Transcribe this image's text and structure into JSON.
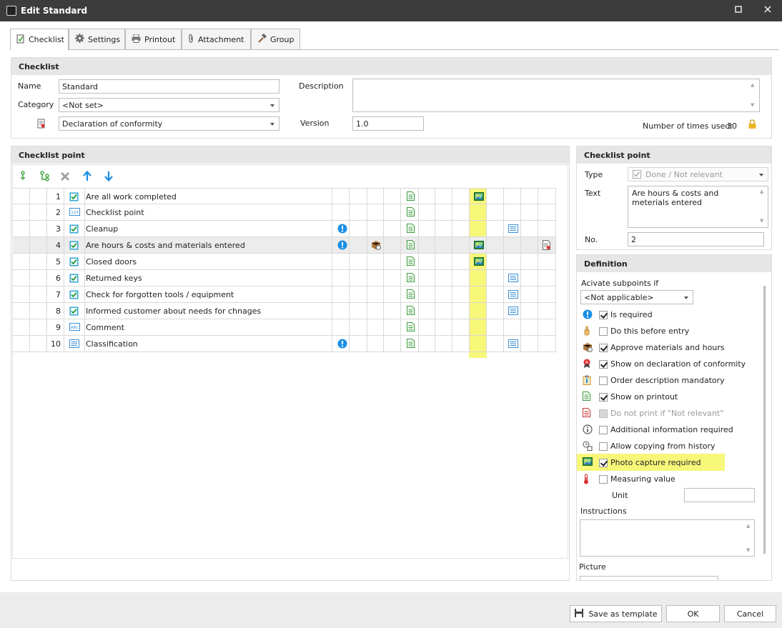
{
  "window": {
    "title": "Edit Standard"
  },
  "tabs": [
    {
      "label": "Checklist",
      "icon": "checklist-icon"
    },
    {
      "label": "Settings",
      "icon": "gear-icon"
    },
    {
      "label": "Printout",
      "icon": "printer-icon"
    },
    {
      "label": "Attachment",
      "icon": "paperclip-icon"
    },
    {
      "label": "Group",
      "icon": "hammer-icon"
    }
  ],
  "checklist": {
    "header": "Checklist",
    "name_label": "Name",
    "name_value": "Standard",
    "category_label": "Category",
    "category_value": "<Not set>",
    "conformity_value": "Declaration of conformity",
    "description_label": "Description",
    "description_value": "",
    "version_label": "Version",
    "version_value": "1.0",
    "times_used_label": "Number of times used:",
    "times_used_value": "30"
  },
  "points_panel": {
    "header": "Checklist point",
    "rows": [
      {
        "no": "1",
        "text": "Are all work completed",
        "type": "check",
        "req": false,
        "mat": false,
        "print": true,
        "photo": true,
        "list": false,
        "decl": false
      },
      {
        "no": "2",
        "text": "Checklist point",
        "type": "number",
        "req": false,
        "mat": false,
        "print": true,
        "photo": false,
        "list": false,
        "decl": false
      },
      {
        "no": "3",
        "text": "Cleanup",
        "type": "check",
        "req": true,
        "mat": false,
        "print": true,
        "photo": false,
        "list": true,
        "decl": false
      },
      {
        "no": "4",
        "text": "Are hours & costs and materials entered",
        "type": "check",
        "req": true,
        "mat": true,
        "print": true,
        "photo": true,
        "list": false,
        "decl": true
      },
      {
        "no": "5",
        "text": "Closed doors",
        "type": "check",
        "req": false,
        "mat": false,
        "print": true,
        "photo": true,
        "list": false,
        "decl": false
      },
      {
        "no": "6",
        "text": "Returned keys",
        "type": "check",
        "req": false,
        "mat": false,
        "print": true,
        "photo": false,
        "list": true,
        "decl": false
      },
      {
        "no": "7",
        "text": "Check for forgotten tools / equipment",
        "type": "check",
        "req": false,
        "mat": false,
        "print": true,
        "photo": false,
        "list": true,
        "decl": false
      },
      {
        "no": "8",
        "text": "Informed customer about needs for chnages",
        "type": "check",
        "req": false,
        "mat": false,
        "print": true,
        "photo": false,
        "list": true,
        "decl": false
      },
      {
        "no": "9",
        "text": "Comment",
        "type": "text",
        "req": false,
        "mat": false,
        "print": true,
        "photo": false,
        "list": false,
        "decl": false
      },
      {
        "no": "10",
        "text": "Classification",
        "type": "list",
        "req": true,
        "mat": false,
        "print": true,
        "photo": false,
        "list": true,
        "decl": false
      }
    ]
  },
  "detail": {
    "header": "Checklist point",
    "type_label": "Type",
    "type_value": "Done / Not relevant",
    "text_label": "Text",
    "text_value": "Are hours & costs and meterials entered",
    "no_label": "No.",
    "no_value": "2"
  },
  "definition": {
    "header": "Definition",
    "activate_label": "Acivate subpoints if",
    "activate_value": "<Not applicable>",
    "options": [
      {
        "label": "Is required",
        "checked": true,
        "disabled": false,
        "icon": "exclamation-icon"
      },
      {
        "label": "Do this before entry",
        "checked": false,
        "disabled": false,
        "icon": "hand-icon"
      },
      {
        "label": "Approve materials and hours",
        "checked": true,
        "disabled": false,
        "icon": "box-icon"
      },
      {
        "label": "Show on declaration of conformity",
        "checked": true,
        "disabled": false,
        "icon": "ribbon-icon"
      },
      {
        "label": "Order description mandatory",
        "checked": false,
        "disabled": false,
        "icon": "clipboard-icon"
      },
      {
        "label": "Show on printout",
        "checked": true,
        "disabled": false,
        "icon": "document-icon"
      },
      {
        "label": "Do not print if \"Not relevant\"",
        "checked": false,
        "disabled": true,
        "icon": "document-red-icon"
      },
      {
        "label": "Additional information required",
        "checked": false,
        "disabled": false,
        "icon": "info-icon"
      },
      {
        "label": "Allow copying from history",
        "checked": false,
        "disabled": false,
        "icon": "copy-history-icon"
      },
      {
        "label": "Photo capture required",
        "checked": true,
        "disabled": false,
        "icon": "photo-icon"
      },
      {
        "label": "Measuring value",
        "checked": false,
        "disabled": false,
        "icon": "thermometer-icon"
      }
    ],
    "unit_label": "Unit",
    "unit_value": "",
    "instructions_label": "Instructions",
    "instructions_value": "",
    "picture_label": "Picture"
  },
  "footer": {
    "save_template_label": "Save as template",
    "ok_label": "OK",
    "cancel_label": "Cancel"
  },
  "colors": {
    "highlight": "#f7f77a",
    "titlebar": "#3c3c3c",
    "header": "#e6e6e6",
    "accent_blue": "#1b8fe6"
  }
}
